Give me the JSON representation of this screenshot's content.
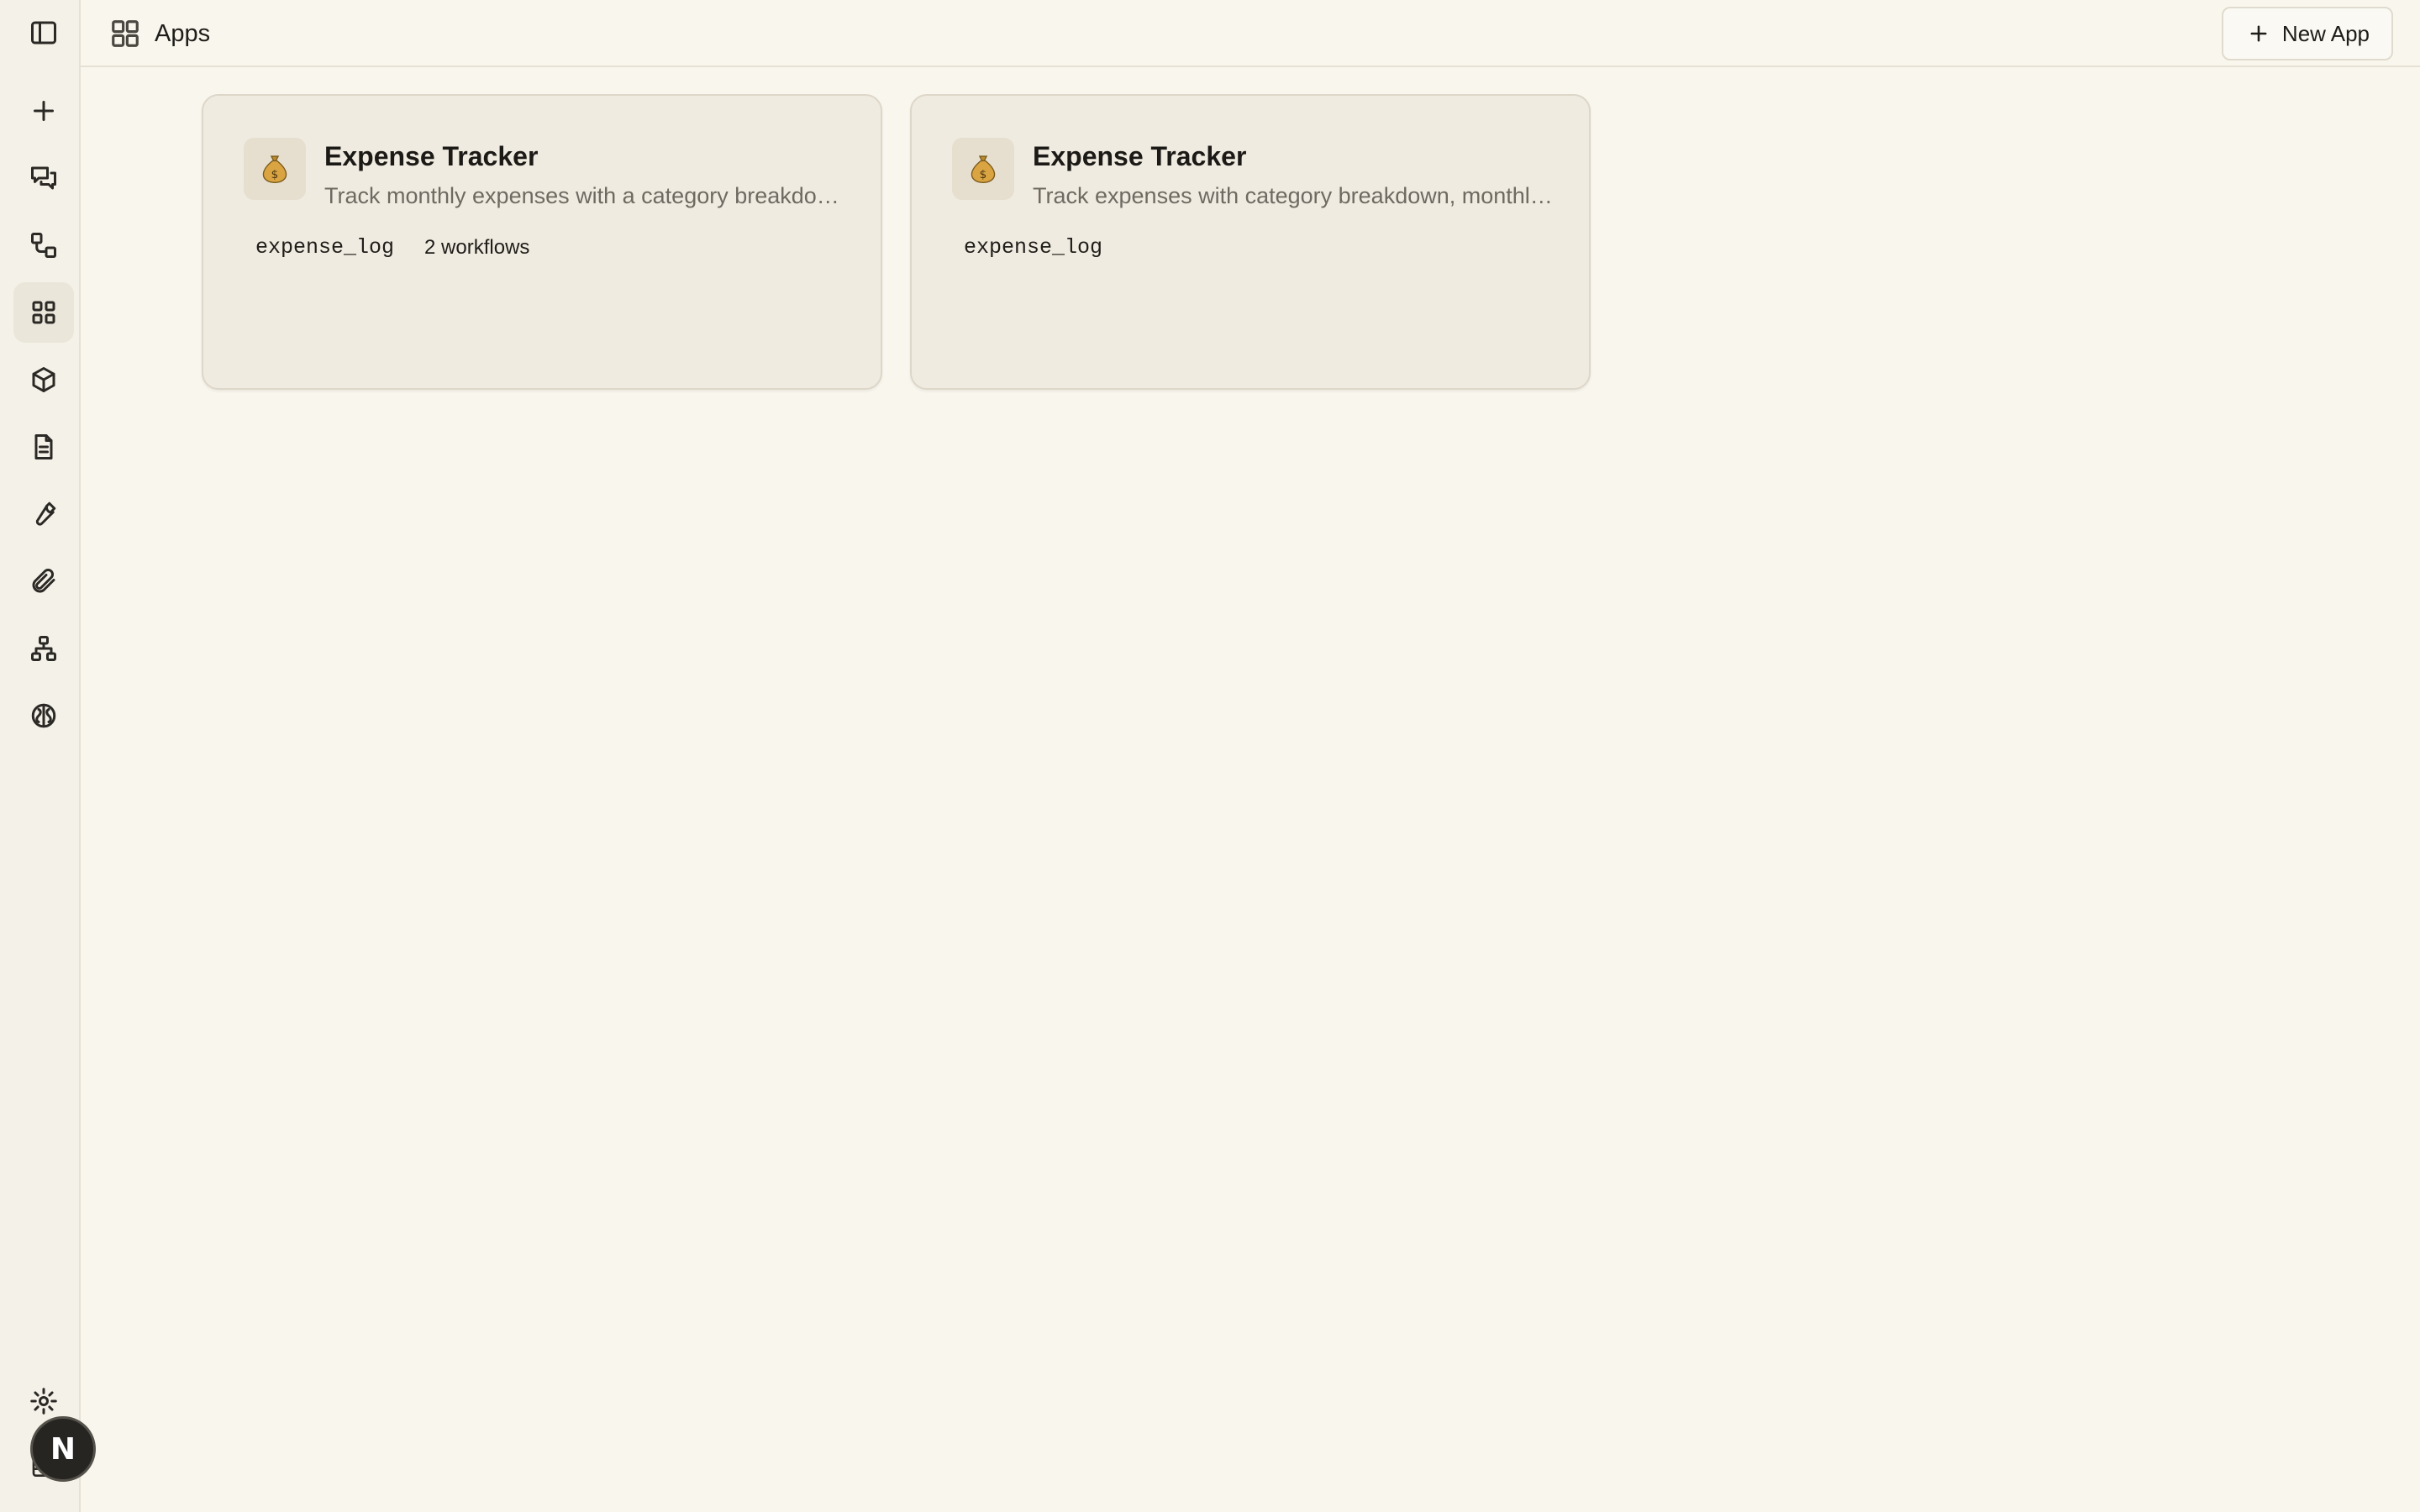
{
  "header": {
    "title": "Apps",
    "new_app_label": "New App"
  },
  "sidebar": {
    "items": [
      {
        "icon": "panel-toggle-icon"
      },
      {
        "icon": "plus-icon"
      },
      {
        "icon": "chat-icon"
      },
      {
        "icon": "workflow-icon"
      },
      {
        "icon": "apps-grid-icon",
        "active": true
      },
      {
        "icon": "box-icon"
      },
      {
        "icon": "document-icon"
      },
      {
        "icon": "wrench-icon"
      },
      {
        "icon": "paperclip-icon"
      },
      {
        "icon": "network-icon"
      },
      {
        "icon": "brain-icon"
      },
      {
        "icon": "gear-icon"
      }
    ],
    "avatar_initial": "N"
  },
  "apps": [
    {
      "title": "Expense Tracker",
      "description": "Track monthly expenses with a category breakdown and budget overview",
      "table": "expense_log",
      "workflows": "2 workflows",
      "icon": "money-bag-icon"
    },
    {
      "title": "Expense Tracker",
      "description": "Track expenses with category breakdown, monthly totals and charts",
      "table": "expense_log",
      "workflows": "",
      "icon": "money-bag-icon"
    }
  ],
  "colors": {
    "background": "#f9f6ee",
    "sidebar": "#f4f1e8",
    "card": "#f0ebe0",
    "border": "#ddd7c9",
    "text": "#1f1d1a",
    "muted": "#6e6a62"
  }
}
